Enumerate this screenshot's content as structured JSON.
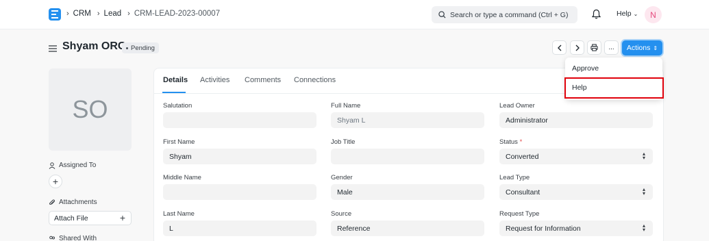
{
  "navbar": {
    "logo_letter": "E",
    "breadcrumbs": [
      "CRM",
      "Lead",
      "CRM-LEAD-2023-00007"
    ],
    "search_placeholder": "Search or type a command (Ctrl + G)",
    "help_label": "Help",
    "avatar_initial": "N"
  },
  "page": {
    "title": "Shyam ORG",
    "status": "Pending",
    "actions_label": "Actions",
    "more_label": "..."
  },
  "dropdown": {
    "items": [
      "Approve",
      "Help"
    ]
  },
  "sidebar": {
    "image_initials": "SO",
    "assigned_to_label": "Assigned To",
    "attachments_label": "Attachments",
    "attach_file_label": "Attach File",
    "shared_with_label": "Shared With"
  },
  "tabs": [
    "Details",
    "Activities",
    "Comments",
    "Connections"
  ],
  "form": {
    "salutation": {
      "label": "Salutation",
      "value": ""
    },
    "full_name": {
      "label": "Full Name",
      "value": "Shyam L"
    },
    "lead_owner": {
      "label": "Lead Owner",
      "value": "Administrator"
    },
    "first_name": {
      "label": "First Name",
      "value": "Shyam"
    },
    "job_title": {
      "label": "Job Title",
      "value": ""
    },
    "status": {
      "label": "Status",
      "required_mark": "*",
      "value": "Converted"
    },
    "middle_name": {
      "label": "Middle Name",
      "value": ""
    },
    "gender": {
      "label": "Gender",
      "value": "Male"
    },
    "lead_type": {
      "label": "Lead Type",
      "value": "Consultant"
    },
    "last_name": {
      "label": "Last Name",
      "value": "L"
    },
    "source": {
      "label": "Source",
      "value": "Reference"
    },
    "request_type": {
      "label": "Request Type",
      "value": "Request for Information"
    }
  },
  "colors": {
    "primary": "#2490ef",
    "highlight_box": "#e0000b",
    "avatar_bg": "#fde7ef",
    "avatar_fg": "#e5487c"
  }
}
